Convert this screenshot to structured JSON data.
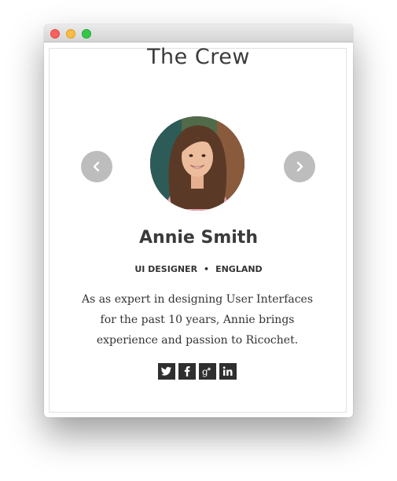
{
  "section": {
    "title": "The Crew"
  },
  "member": {
    "name": "Annie Smith",
    "role": "UI DESIGNER",
    "separator": "•",
    "location": "ENGLAND",
    "bio": "As as expert in designing User Interfaces for the past 10 years, Annie brings experience and passion to Ricochet."
  },
  "carousel": {
    "prev_icon": "chevron-left-icon",
    "next_icon": "chevron-right-icon"
  },
  "social": [
    {
      "icon": "twitter-icon"
    },
    {
      "icon": "facebook-icon"
    },
    {
      "icon": "google-plus-icon"
    },
    {
      "icon": "linkedin-icon"
    }
  ],
  "window": {
    "controls": [
      "close",
      "minimize",
      "zoom"
    ]
  },
  "colors": {
    "title_text": "#3b3b3b",
    "arrow_bg": "#bdbdbd",
    "social_bg": "#2f2f2f"
  }
}
